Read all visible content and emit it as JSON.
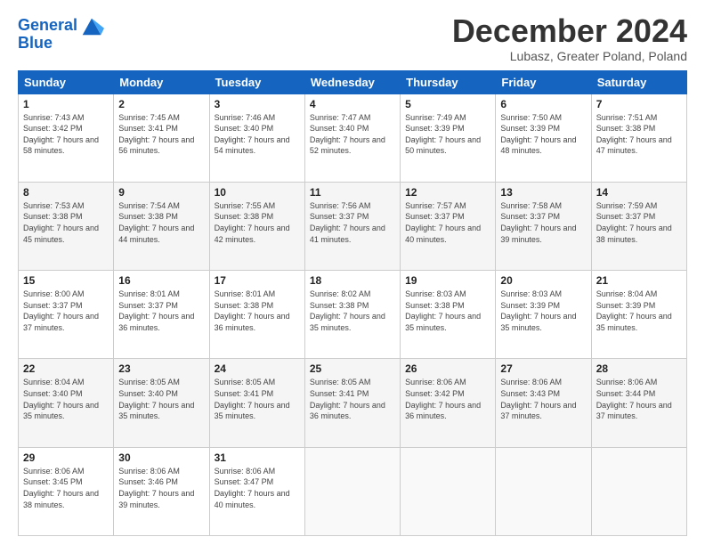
{
  "logo": {
    "line1": "General",
    "line2": "Blue"
  },
  "title": "December 2024",
  "subtitle": "Lubasz, Greater Poland, Poland",
  "headers": [
    "Sunday",
    "Monday",
    "Tuesday",
    "Wednesday",
    "Thursday",
    "Friday",
    "Saturday"
  ],
  "weeks": [
    [
      {
        "day": "1",
        "sunrise": "Sunrise: 7:43 AM",
        "sunset": "Sunset: 3:42 PM",
        "daylight": "Daylight: 7 hours and 58 minutes."
      },
      {
        "day": "2",
        "sunrise": "Sunrise: 7:45 AM",
        "sunset": "Sunset: 3:41 PM",
        "daylight": "Daylight: 7 hours and 56 minutes."
      },
      {
        "day": "3",
        "sunrise": "Sunrise: 7:46 AM",
        "sunset": "Sunset: 3:40 PM",
        "daylight": "Daylight: 7 hours and 54 minutes."
      },
      {
        "day": "4",
        "sunrise": "Sunrise: 7:47 AM",
        "sunset": "Sunset: 3:40 PM",
        "daylight": "Daylight: 7 hours and 52 minutes."
      },
      {
        "day": "5",
        "sunrise": "Sunrise: 7:49 AM",
        "sunset": "Sunset: 3:39 PM",
        "daylight": "Daylight: 7 hours and 50 minutes."
      },
      {
        "day": "6",
        "sunrise": "Sunrise: 7:50 AM",
        "sunset": "Sunset: 3:39 PM",
        "daylight": "Daylight: 7 hours and 48 minutes."
      },
      {
        "day": "7",
        "sunrise": "Sunrise: 7:51 AM",
        "sunset": "Sunset: 3:38 PM",
        "daylight": "Daylight: 7 hours and 47 minutes."
      }
    ],
    [
      {
        "day": "8",
        "sunrise": "Sunrise: 7:53 AM",
        "sunset": "Sunset: 3:38 PM",
        "daylight": "Daylight: 7 hours and 45 minutes."
      },
      {
        "day": "9",
        "sunrise": "Sunrise: 7:54 AM",
        "sunset": "Sunset: 3:38 PM",
        "daylight": "Daylight: 7 hours and 44 minutes."
      },
      {
        "day": "10",
        "sunrise": "Sunrise: 7:55 AM",
        "sunset": "Sunset: 3:38 PM",
        "daylight": "Daylight: 7 hours and 42 minutes."
      },
      {
        "day": "11",
        "sunrise": "Sunrise: 7:56 AM",
        "sunset": "Sunset: 3:37 PM",
        "daylight": "Daylight: 7 hours and 41 minutes."
      },
      {
        "day": "12",
        "sunrise": "Sunrise: 7:57 AM",
        "sunset": "Sunset: 3:37 PM",
        "daylight": "Daylight: 7 hours and 40 minutes."
      },
      {
        "day": "13",
        "sunrise": "Sunrise: 7:58 AM",
        "sunset": "Sunset: 3:37 PM",
        "daylight": "Daylight: 7 hours and 39 minutes."
      },
      {
        "day": "14",
        "sunrise": "Sunrise: 7:59 AM",
        "sunset": "Sunset: 3:37 PM",
        "daylight": "Daylight: 7 hours and 38 minutes."
      }
    ],
    [
      {
        "day": "15",
        "sunrise": "Sunrise: 8:00 AM",
        "sunset": "Sunset: 3:37 PM",
        "daylight": "Daylight: 7 hours and 37 minutes."
      },
      {
        "day": "16",
        "sunrise": "Sunrise: 8:01 AM",
        "sunset": "Sunset: 3:37 PM",
        "daylight": "Daylight: 7 hours and 36 minutes."
      },
      {
        "day": "17",
        "sunrise": "Sunrise: 8:01 AM",
        "sunset": "Sunset: 3:38 PM",
        "daylight": "Daylight: 7 hours and 36 minutes."
      },
      {
        "day": "18",
        "sunrise": "Sunrise: 8:02 AM",
        "sunset": "Sunset: 3:38 PM",
        "daylight": "Daylight: 7 hours and 35 minutes."
      },
      {
        "day": "19",
        "sunrise": "Sunrise: 8:03 AM",
        "sunset": "Sunset: 3:38 PM",
        "daylight": "Daylight: 7 hours and 35 minutes."
      },
      {
        "day": "20",
        "sunrise": "Sunrise: 8:03 AM",
        "sunset": "Sunset: 3:39 PM",
        "daylight": "Daylight: 7 hours and 35 minutes."
      },
      {
        "day": "21",
        "sunrise": "Sunrise: 8:04 AM",
        "sunset": "Sunset: 3:39 PM",
        "daylight": "Daylight: 7 hours and 35 minutes."
      }
    ],
    [
      {
        "day": "22",
        "sunrise": "Sunrise: 8:04 AM",
        "sunset": "Sunset: 3:40 PM",
        "daylight": "Daylight: 7 hours and 35 minutes."
      },
      {
        "day": "23",
        "sunrise": "Sunrise: 8:05 AM",
        "sunset": "Sunset: 3:40 PM",
        "daylight": "Daylight: 7 hours and 35 minutes."
      },
      {
        "day": "24",
        "sunrise": "Sunrise: 8:05 AM",
        "sunset": "Sunset: 3:41 PM",
        "daylight": "Daylight: 7 hours and 35 minutes."
      },
      {
        "day": "25",
        "sunrise": "Sunrise: 8:05 AM",
        "sunset": "Sunset: 3:41 PM",
        "daylight": "Daylight: 7 hours and 36 minutes."
      },
      {
        "day": "26",
        "sunrise": "Sunrise: 8:06 AM",
        "sunset": "Sunset: 3:42 PM",
        "daylight": "Daylight: 7 hours and 36 minutes."
      },
      {
        "day": "27",
        "sunrise": "Sunrise: 8:06 AM",
        "sunset": "Sunset: 3:43 PM",
        "daylight": "Daylight: 7 hours and 37 minutes."
      },
      {
        "day": "28",
        "sunrise": "Sunrise: 8:06 AM",
        "sunset": "Sunset: 3:44 PM",
        "daylight": "Daylight: 7 hours and 37 minutes."
      }
    ],
    [
      {
        "day": "29",
        "sunrise": "Sunrise: 8:06 AM",
        "sunset": "Sunset: 3:45 PM",
        "daylight": "Daylight: 7 hours and 38 minutes."
      },
      {
        "day": "30",
        "sunrise": "Sunrise: 8:06 AM",
        "sunset": "Sunset: 3:46 PM",
        "daylight": "Daylight: 7 hours and 39 minutes."
      },
      {
        "day": "31",
        "sunrise": "Sunrise: 8:06 AM",
        "sunset": "Sunset: 3:47 PM",
        "daylight": "Daylight: 7 hours and 40 minutes."
      },
      null,
      null,
      null,
      null
    ]
  ]
}
